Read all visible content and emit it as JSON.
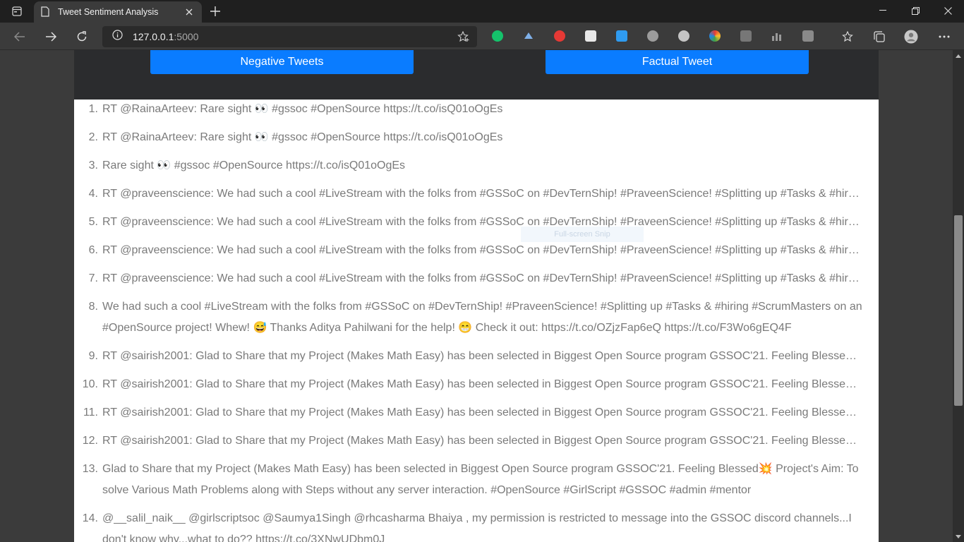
{
  "browser": {
    "tab_title": "Tweet Sentiment Analysis",
    "url_host": "127.0.0.1",
    "url_port": ":5000"
  },
  "page": {
    "negative_button": "Negative Tweets",
    "factual_button": "Factual Tweet",
    "overlay_text": "Full-screen Snip",
    "tweets": [
      {
        "n": "1.",
        "text": "RT @RainaArteev: Rare sight 👀 #gssoc #OpenSource https://t.co/isQ01oOgEs"
      },
      {
        "n": "2.",
        "text": "RT @RainaArteev: Rare sight 👀 #gssoc #OpenSource https://t.co/isQ01oOgEs"
      },
      {
        "n": "3.",
        "text": "Rare sight 👀 #gssoc #OpenSource https://t.co/isQ01oOgEs"
      },
      {
        "n": "4.",
        "text": "RT @praveenscience: We had such a cool #LiveStream with the folks from #GSSoC on #DevTernShip! #PraveenScience! #Splitting up #Tasks & #hir…"
      },
      {
        "n": "5.",
        "text": "RT @praveenscience: We had such a cool #LiveStream with the folks from #GSSoC on #DevTernShip! #PraveenScience! #Splitting up #Tasks & #hir…"
      },
      {
        "n": "6.",
        "text": "RT @praveenscience: We had such a cool #LiveStream with the folks from #GSSoC on #DevTernShip! #PraveenScience! #Splitting up #Tasks & #hir…"
      },
      {
        "n": "7.",
        "text": "RT @praveenscience: We had such a cool #LiveStream with the folks from #GSSoC on #DevTernShip! #PraveenScience! #Splitting up #Tasks & #hir…"
      },
      {
        "n": "8.",
        "text": "We had such a cool #LiveStream with the folks from #GSSoC on #DevTernShip! #PraveenScience! #Splitting up #Tasks & #hiring #ScrumMasters on an #OpenSource project! Whew! 😅 Thanks Aditya Pahilwani for the help! 😁 Check it out: https://t.co/OZjzFap6eQ https://t.co/F3Wo6gEQ4F"
      },
      {
        "n": "9.",
        "text": "RT @sairish2001: Glad to Share that my Project (Makes Math Easy) has been selected in Biggest Open Source program GSSOC'21. Feeling Blesse…"
      },
      {
        "n": "10.",
        "text": "RT @sairish2001: Glad to Share that my Project (Makes Math Easy) has been selected in Biggest Open Source program GSSOC'21. Feeling Blesse…"
      },
      {
        "n": "11.",
        "text": "RT @sairish2001: Glad to Share that my Project (Makes Math Easy) has been selected in Biggest Open Source program GSSOC'21. Feeling Blesse…"
      },
      {
        "n": "12.",
        "text": "RT @sairish2001: Glad to Share that my Project (Makes Math Easy) has been selected in Biggest Open Source program GSSOC'21. Feeling Blesse…"
      },
      {
        "n": "13.",
        "text": "Glad to Share that my Project (Makes Math Easy) has been selected in Biggest Open Source program GSSOC'21. Feeling Blessed💥 Project's Aim: To solve Various Math Problems along with Steps without any server interaction. #OpenSource #GirlScript #GSSOC #admin #mentor"
      },
      {
        "n": "14.",
        "text": "@__salil_naik__ @girlscriptsoc @Saumya1Singh @rhcasharma Bhaiya , my permission is restricted to message into the GSSOC discord channels...I don't know why...what to do?? https://t.co/3XNwUDbm0J"
      }
    ]
  },
  "colors": {
    "button_blue": "#0a7cff",
    "header_dark": "#2b2c2e",
    "tweet_text": "#7a7a7a",
    "chrome_bg": "#3b3b3b"
  }
}
